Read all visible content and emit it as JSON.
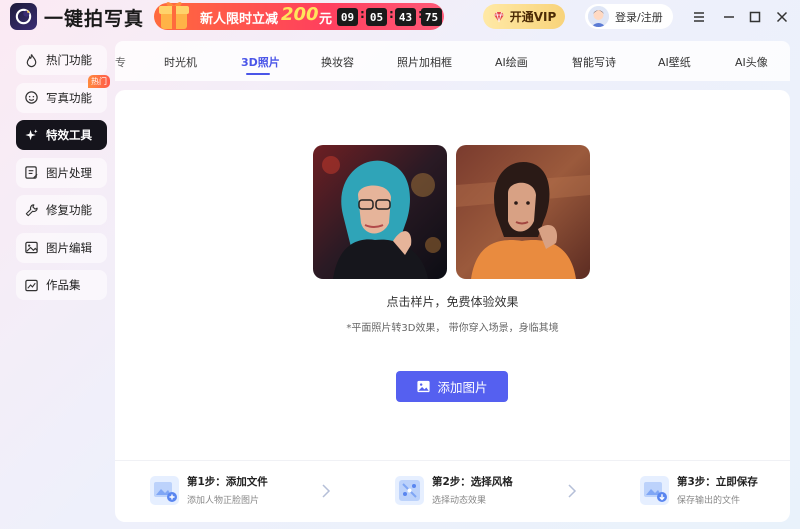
{
  "app": {
    "title": "一键拍写真"
  },
  "promo": {
    "text": "新人限时立减",
    "amount": "200",
    "unit": "元",
    "countdown": [
      "09",
      "05",
      "43",
      "75"
    ]
  },
  "header": {
    "vip_label": "开通VIP",
    "login_label": "登录/注册"
  },
  "sidebar": {
    "items": [
      {
        "label": "热门功能",
        "icon": "flame-icon",
        "active": false
      },
      {
        "label": "写真功能",
        "icon": "face-icon",
        "active": false,
        "badge": "热门"
      },
      {
        "label": "特效工具",
        "icon": "sparkle-icon",
        "active": true
      },
      {
        "label": "图片处理",
        "icon": "image-edit-icon",
        "active": false
      },
      {
        "label": "修复功能",
        "icon": "wrench-icon",
        "active": false
      },
      {
        "label": "图片编辑",
        "icon": "picture-icon",
        "active": false
      },
      {
        "label": "作品集",
        "icon": "gallery-icon",
        "active": false
      }
    ]
  },
  "tabs": {
    "partial_label": "专",
    "items": [
      {
        "label": "时光机",
        "active": false
      },
      {
        "label": "3D照片",
        "active": true
      },
      {
        "label": "换妆容",
        "active": false
      },
      {
        "label": "照片加相框",
        "active": false
      },
      {
        "label": "AI绘画",
        "active": false
      },
      {
        "label": "智能写诗",
        "active": false
      },
      {
        "label": "AI壁纸",
        "active": false
      },
      {
        "label": "AI头像",
        "active": false
      }
    ]
  },
  "main": {
    "hint": "点击样片，免费体验效果",
    "subhint": "*平面照片转3D效果， 带你穿入场景，身临其境",
    "add_button": "添加图片"
  },
  "steps": [
    {
      "title": "第1步：添加文件",
      "desc": "添加人物正脸图片"
    },
    {
      "title": "第2步：选择风格",
      "desc": "选择动态效果"
    },
    {
      "title": "第3步：立即保存",
      "desc": "保存输出的文件"
    }
  ],
  "colors": {
    "accent": "#4a55e8",
    "button": "#5560f0",
    "promo": "#ff4d5e",
    "vip": "#f8d37a"
  }
}
